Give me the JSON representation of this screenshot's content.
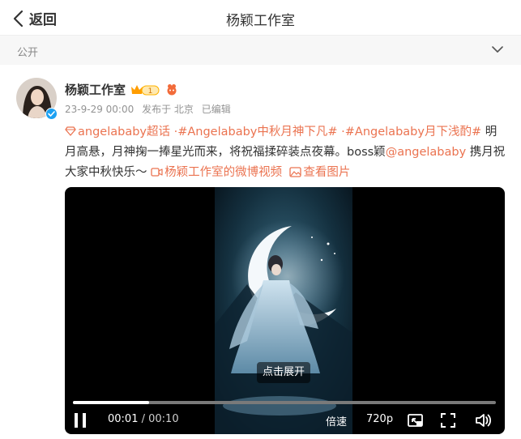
{
  "header": {
    "back_label": "返回",
    "title": "杨颖工作室"
  },
  "visibility": {
    "label": "公开"
  },
  "post": {
    "author": "杨颖工作室",
    "vip_level": "1",
    "time": "23-9-29 00:00",
    "location": "发布于 北京",
    "edited": "已编辑",
    "text": {
      "supertopic": "angelababy超话",
      "sep1": " ·",
      "topic1": "#Angelababy中秋月神下凡#",
      "sep2": " ·",
      "topic2": "#Angelababy月下浅酌#",
      "body1": " 明月高悬，月神掬一捧星光而来，将祝福揉碎装点夜幕。boss颖",
      "mention": "@angelababy",
      "body2": " 携月祝大家中秋快乐～ ",
      "video_link": "杨颖工作室的微博视频",
      "pic_link": "查看图片"
    }
  },
  "video": {
    "expand_label": "点击展开",
    "current_time": "00:01",
    "separator": " / ",
    "duration": "00:10",
    "progress": 0.18,
    "speed_label": "倍速",
    "quality_label": "720p"
  },
  "colors": {
    "link": "#eb7350",
    "accent": "#ff8200",
    "verified": "#1da1f2"
  }
}
